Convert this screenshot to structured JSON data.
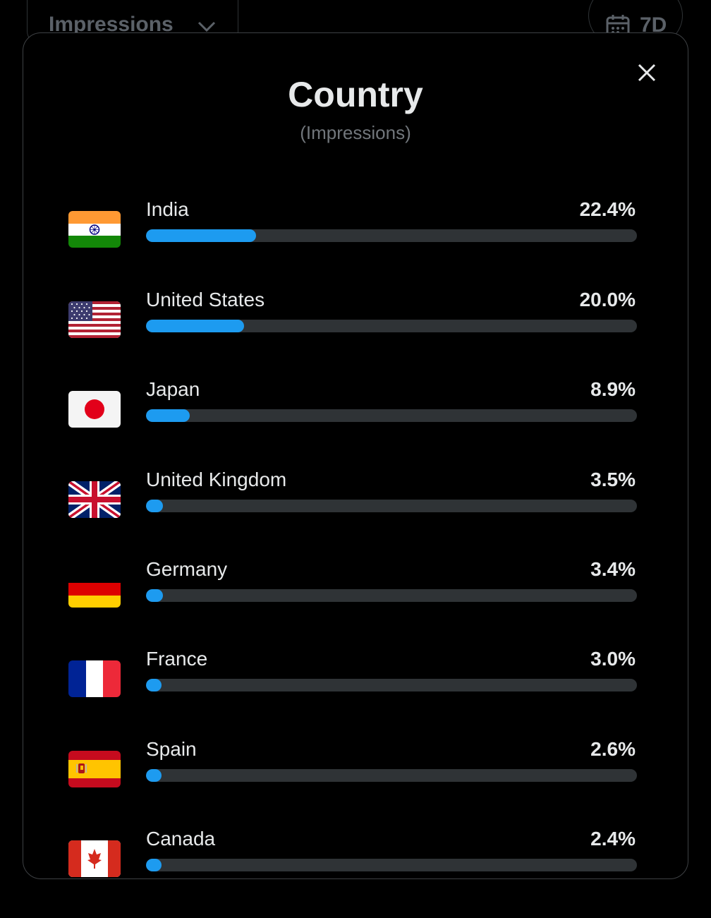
{
  "background": {
    "dropdown_label": "Impressions",
    "range_label": "7D"
  },
  "modal": {
    "title": "Country",
    "subtitle": "(Impressions)",
    "close_icon": "close-icon"
  },
  "countries": [
    {
      "name": "India",
      "percent": "22.4%",
      "value": 22.4,
      "flag": "india-flag-icon"
    },
    {
      "name": "United States",
      "percent": "20.0%",
      "value": 20.0,
      "flag": "us-flag-icon"
    },
    {
      "name": "Japan",
      "percent": "8.9%",
      "value": 8.9,
      "flag": "japan-flag-icon"
    },
    {
      "name": "United Kingdom",
      "percent": "3.5%",
      "value": 3.5,
      "flag": "uk-flag-icon"
    },
    {
      "name": "Germany",
      "percent": "3.4%",
      "value": 3.4,
      "flag": "germany-flag-icon"
    },
    {
      "name": "France",
      "percent": "3.0%",
      "value": 3.0,
      "flag": "france-flag-icon"
    },
    {
      "name": "Spain",
      "percent": "2.6%",
      "value": 2.6,
      "flag": "spain-flag-icon"
    },
    {
      "name": "Canada",
      "percent": "2.4%",
      "value": 2.4,
      "flag": "canada-flag-icon"
    }
  ],
  "colors": {
    "accent": "#1d9bf0",
    "track": "#2f3336",
    "text": "#e7e9ea",
    "muted": "#71767b"
  }
}
